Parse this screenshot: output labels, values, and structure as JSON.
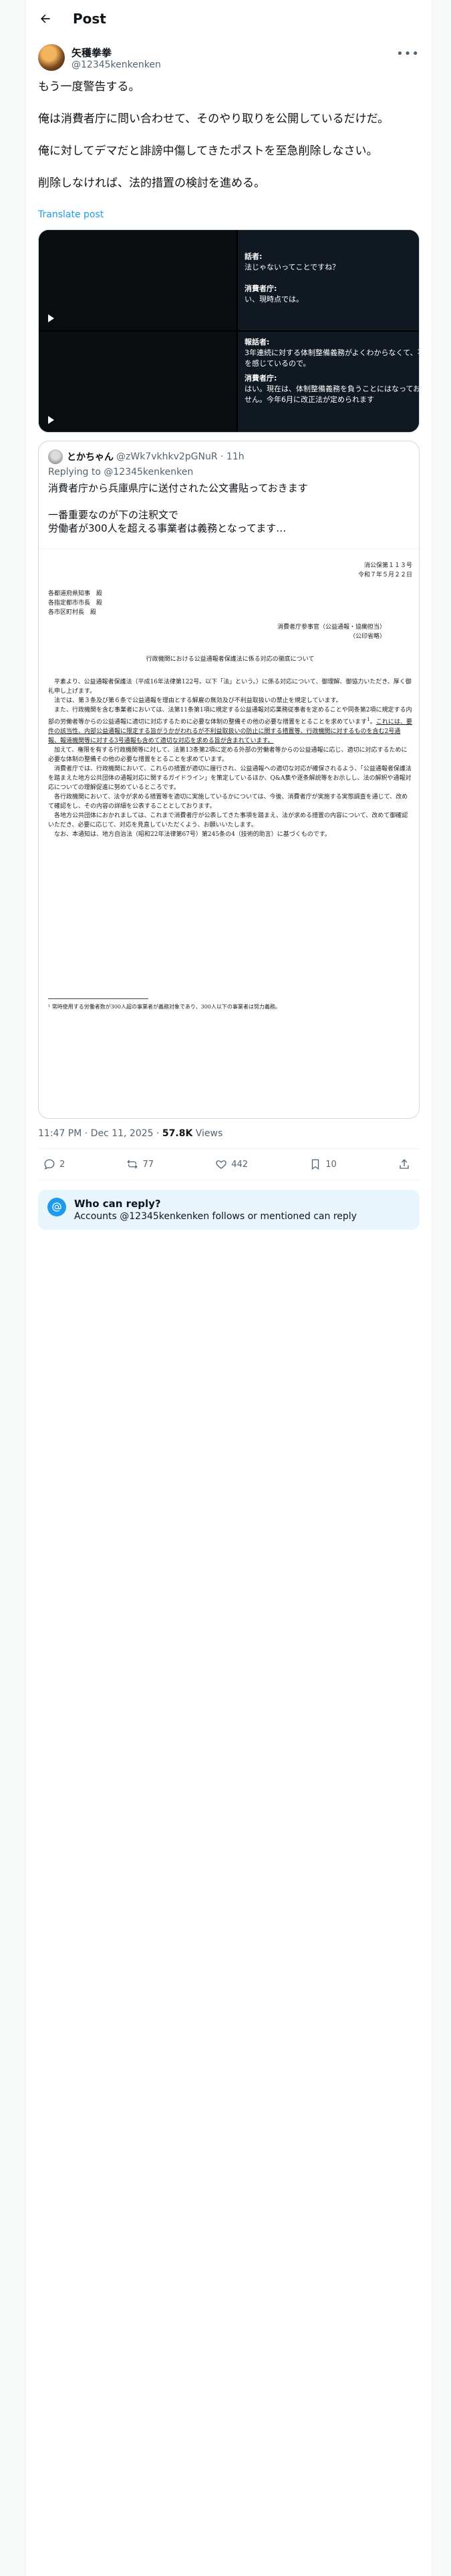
{
  "header": {
    "title": "Post"
  },
  "author": {
    "name": "矢穫拳拳",
    "handle": "@12345kenkenken"
  },
  "post": {
    "lines": [
      "もう一度警告する。",
      "俺は消費者庁に問い合わせて、そのやり取りを公開しているだけだ。",
      "俺に対してデマだと誹謗中傷してきたポストを至急削除しなさい。",
      "削除しなければ、法的措置の検討を進める。"
    ],
    "translate": "Translate post"
  },
  "media": {
    "sub1": {
      "l1": "話者:",
      "l2": "法じゃないってことですね？",
      "l3": "",
      "l4": "消費者庁:",
      "l5": "い、現時点では。"
    },
    "sub2": {
      "l1": "報話者:",
      "l2": "3年連続に対する体制整備義務がよくわからなくて、不安を感じているので。",
      "l3": "消費者庁:",
      "l4": "はい。現在は、体制整備義務を負うことにはなっておりません。今年6月に改正法が定められます"
    }
  },
  "quote": {
    "name": "とかちゃん",
    "meta": "@zWk7vkhkv2pGNuR · 11h",
    "reply": "Replying to @12345kenkenken",
    "lines": [
      "消費者庁から兵庫県庁に送付された公文書貼っておきます",
      "一番重要なのが下の注釈文で\n労働者が300人を超える事業者は義務となってます…"
    ],
    "doc": {
      "no": "消公保第１１３号",
      "date": "令和７年５月２２日",
      "to1": "各都道府県知事　殿",
      "to2": "各指定都市市長　殿",
      "to3": "各市区町村長　殿",
      "from": "消費者庁参事官（公益通報・協働担当）",
      "seal": "（公印省略）",
      "subject": "行政機関における公益通報者保護法に係る対応の徹底について",
      "p1": "平素より、公益通報者保護法（平成16年法律第122号。以下「法」という。）に係る対応について、御理解、御協力いただき、厚く御礼申し上げます。",
      "p2": "法では、第３条及び第６条で公益通報を理由とする解雇の無効及び不利益取扱いの禁止を規定しています。",
      "p3a": "また、行政機関を含む事業者においては、法第11条第1項に規定する公益通報対応業務従事者を定めることや同条第2項に規定する内部の労働者等からの公益通報に適切に対応するために必要な体制の整備その他の必要な措置をとることを求めています",
      "p3b": "これには、要件の該当性、内部公益通報に限定する旨がうかがわれるが不利益取扱いの防止に関する措置等、行政機関に対するものを含む2号通報、報道機関等に対する3号通報も含めて適切な対応を求める旨が含まれています。",
      "p4": "加えて、権限を有する行政機関等に対して、法第13条第2項に定める外部の労働者等からの公益通報に応じ、適切に対応するために必要な体制の整備その他の必要な措置をとることを求めています。",
      "p5": "消費者庁では、行政機関において、これらの措置が適切に履行され、公益通報への適切な対応が確保されるよう、「公益通報者保護法を踏まえた地方公共団体の通報対応に関するガイドライン」を策定しているほか、Q&A集や逐条解説等をお示しし、法の解釈や通報対応についての理解促進に努めているところです。",
      "p6": "各行政機関において、法令が求める措置等を適切に実施しているかについては、今後、消費者庁が実施する実態調査を通じて、改めて確認をし、その内容の詳細を公表することとしております。",
      "p7": "各地方公共団体におかれましては、これまで消費者庁が公表してきた事項を踏まえ、法が求める措置の内容について、改めて御確認いただき、必要に応じて、対応を見直していただくよう、お願いいたします。",
      "p8": "なお、本通知は、地方自治法（昭和22年法律第67号）第245条の4（技術的助言）に基づくものです。",
      "foot": "¹ 常時使用する労働者数が300人超の事業者が義務対象であり、300人以下の事業者は努力義務。",
      "page": "1"
    }
  },
  "meta": {
    "time": "11:47 PM · Dec 11, 2025 · ",
    "views": "57.8K",
    "views_label": " Views"
  },
  "actions": {
    "replies": "2",
    "reposts": "77",
    "likes": "442",
    "bookmarks": "10"
  },
  "who": {
    "title": "Who can reply?",
    "text": "Accounts @12345kenkenken follows or mentioned can reply"
  }
}
